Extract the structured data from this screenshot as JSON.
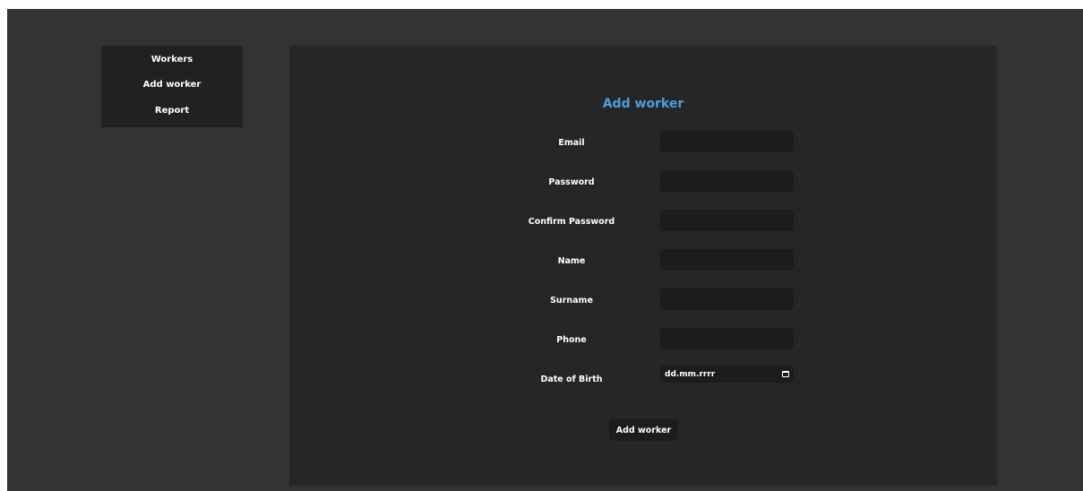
{
  "sidebar": {
    "items": [
      {
        "label": "Workers"
      },
      {
        "label": "Add worker"
      },
      {
        "label": "Report"
      }
    ]
  },
  "form": {
    "title": "Add worker",
    "fields": [
      {
        "label": "Email",
        "value": ""
      },
      {
        "label": "Password",
        "value": ""
      },
      {
        "label": "Confirm Password",
        "value": ""
      },
      {
        "label": "Name",
        "value": ""
      },
      {
        "label": "Surname",
        "value": ""
      },
      {
        "label": "Phone",
        "value": ""
      },
      {
        "label": "Date of Birth",
        "placeholder": "dd.mm.rrrr"
      }
    ],
    "submit_label": "Add worker"
  },
  "icons": {
    "date_picker": "calendar-icon"
  },
  "colors": {
    "page_bg": "#333333",
    "panel_bg": "#262626",
    "sidebar_bg": "#212121",
    "input_bg": "#1c1c1c",
    "title_accent": "#4a9fe0",
    "text": "#ffffff"
  }
}
